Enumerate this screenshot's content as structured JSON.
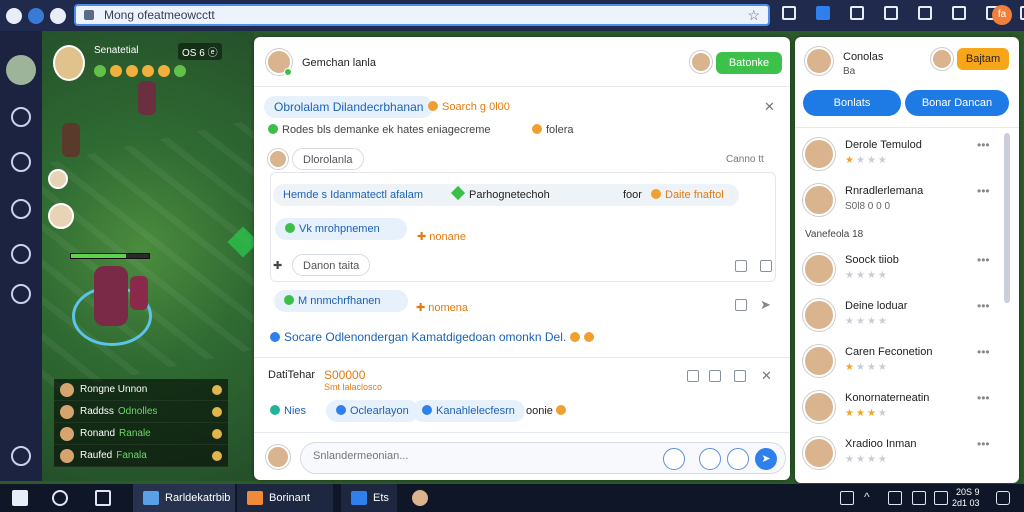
{
  "browser": {
    "url": "Mong ofeatmeowcctt",
    "avatar_letter": "fa",
    "toolbar_icons": [
      "shield-icon",
      "square-icon",
      "image-icon",
      "puzzle-icon",
      "home-icon",
      "folder-icon",
      "camera-icon",
      "window-icon"
    ]
  },
  "game": {
    "player_name": "Senatetial",
    "badge": "OS 6 ⓔ",
    "party": [
      {
        "name": "Rongne Unnon",
        "tag": ""
      },
      {
        "name": "Raddss",
        "tag": "Odnolles"
      },
      {
        "name": "Ronand",
        "tag": "Ranale"
      },
      {
        "name": "Raufed",
        "tag": "Fanala"
      }
    ]
  },
  "chat": {
    "contact_name": "Gemchan lanla",
    "action_button": "Batonke",
    "topic": "Obrolalam Dilandecrbhanan",
    "topic_badge": "Soarch g 0l00",
    "subtitle": "Rodes bls demanke ek hates eniagecreme",
    "subtitle_tag": "folera",
    "mention": "Dlorolanla",
    "mention_meta": "Canno tt",
    "card_line_1": "Hemde s Idanmatectl afalam",
    "card_line_2": "Parhognetechoh",
    "card_line_3": "foor",
    "card_line_4": "Daite fnaftol",
    "bubble_1": "Vk  mrohpnemen",
    "bubble_1_tag": "nonane",
    "search_box": "Danon taita",
    "bubble_2": "M nnmchrfhanen",
    "bubble_2_tag": "nomena",
    "summary": "Socare Odlenondergan Kamatdigedoan omonkn Del.",
    "footer_label": "DatiTehar",
    "footer_value": "S00000",
    "footer_sub": "Smt lalaclosco",
    "chip_1": "Nies",
    "chip_2": "Oclearlayon",
    "chip_3": "Kanahlelecfesrn",
    "chip_3_tag": "oonie",
    "composer_placeholder": "Snlandermeonian..."
  },
  "sidebar": {
    "user_name": "Conolas",
    "user_sub": "Ba",
    "top_button": "Bajtam",
    "button_left": "Bonlats",
    "button_right": "Bonar Dancan",
    "section_label": "Vanefeola 18",
    "contacts": [
      {
        "name": "Derole Temulod",
        "rating": 1
      },
      {
        "name": "Rnradlerlemana",
        "sub": "S0l8 0 0 0"
      },
      {
        "name": "Soock tiiob",
        "rating": 0
      },
      {
        "name": "Deine loduar",
        "rating": 0
      },
      {
        "name": "Caren Feconetion",
        "rating": 1
      },
      {
        "name": "Konornaterneatin",
        "rating": 3
      },
      {
        "name": "Xradioo Inman",
        "rating": 0
      }
    ]
  },
  "taskbar": {
    "task_1": "Rarldekatrbib",
    "task_2": "Borinant",
    "task_3": "Ets",
    "clock_line_1": "20S 9",
    "clock_line_2": "2d1 03"
  }
}
